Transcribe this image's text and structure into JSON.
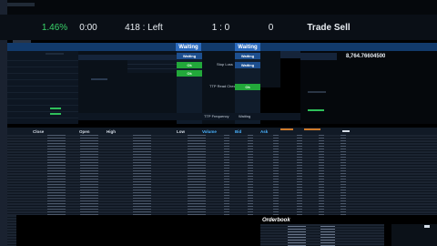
{
  "header": {
    "percent": "1.46%",
    "timer": "0:00",
    "left": "418 : Left",
    "ratio": "1 : 0",
    "count": "0",
    "trade": "Trade Sell"
  },
  "status": {
    "waiting_1": "Waiting",
    "waiting_2": "Waiting",
    "waiting_row": [
      "Waiting",
      "Waiting"
    ],
    "ok_label": "Ok",
    "ttp_label": "TTP Read Check",
    "stop_label": "Stop Loss",
    "ttp_freq": "TTP Frequency",
    "waiting_small": "Waiting"
  },
  "big_value": "8,764.76604500",
  "table_headers": [
    "Close",
    "Open",
    "High",
    "Low"
  ],
  "table_headers_right": [
    "Volume",
    "Bid",
    "Ask"
  ],
  "orderbook": {
    "title": "Orderbook"
  },
  "colors": {
    "blue": "#2c6bbf",
    "green": "#22a83a",
    "bg": "#000000",
    "panel": "#0d1622"
  }
}
